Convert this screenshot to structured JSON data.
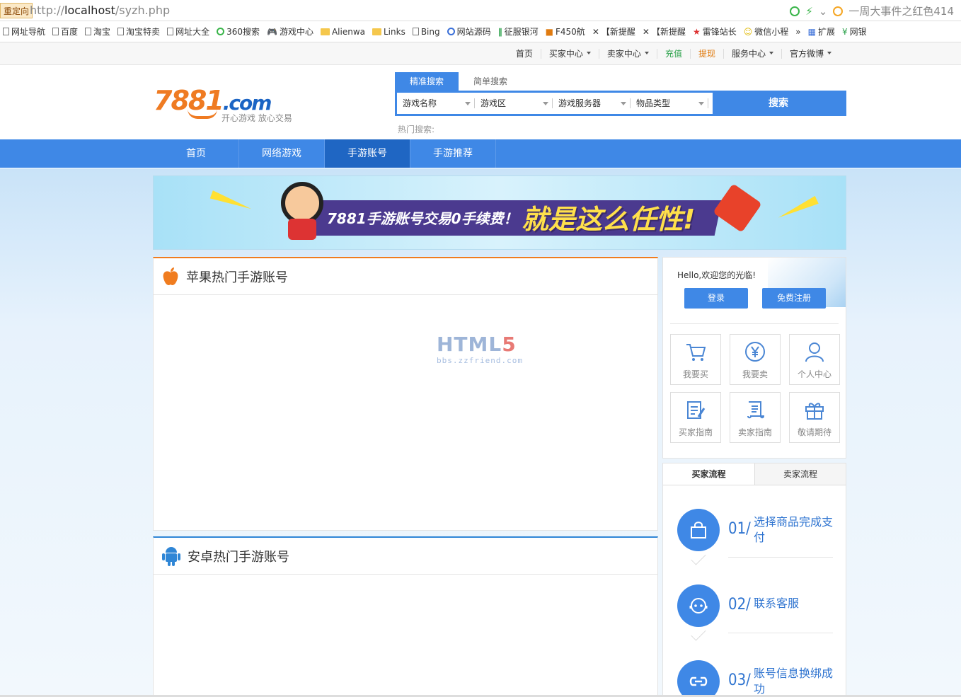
{
  "browser": {
    "redirect_label": "重定向",
    "url_prefix": "http://",
    "url_host": "localhost",
    "url_path": "/syzh.php",
    "right_text": "一周大事件之红色414",
    "bookmarks": [
      "网址导航",
      "百度",
      "淘宝",
      "淘宝特卖",
      "网址大全",
      "360搜索",
      "游戏中心",
      "Alienwa",
      "Links",
      "Bing",
      "网站源码",
      "征服银河",
      "F450航",
      "【新提醒",
      "【新提醒",
      "雷锋站长",
      "微信小程",
      "»",
      "扩展",
      "网银"
    ]
  },
  "topnav": [
    "首页",
    "买家中心",
    "卖家中心",
    "充值",
    "提现",
    "服务中心",
    "官方微博"
  ],
  "logo": {
    "main": "7881",
    "suffix": ".com",
    "slogan": "开心游戏 放心交易"
  },
  "search": {
    "tabs": [
      "精准搜索",
      "简单搜索"
    ],
    "selects": [
      "游戏名称",
      "游戏区",
      "游戏服务器",
      "物品类型"
    ],
    "button": "搜索",
    "hot_label": "热门搜索:"
  },
  "mainnav": [
    "首页",
    "网络游戏",
    "手游账号",
    "手游推荐"
  ],
  "banner": {
    "text1": "7881手游账号交易0手续费！",
    "text2": "就是这么任性!"
  },
  "panels": {
    "apple_title": "苹果热门手游账号",
    "android_title": "安卓热门手游账号",
    "watermark_main": "HTML",
    "watermark_num": "5",
    "watermark_sub": "bbs.zzfriend.com"
  },
  "sidebar": {
    "hello": "Hello,欢迎您的光临!",
    "login": "登录",
    "register": "免费注册",
    "grid": [
      "我要买",
      "我要卖",
      "个人中心",
      "买家指南",
      "卖家指南",
      "敬请期待"
    ]
  },
  "process": {
    "tabs": [
      "买家流程",
      "卖家流程"
    ],
    "steps": [
      {
        "num": "01/",
        "text": "选择商品完成支付"
      },
      {
        "num": "02/",
        "text": "联系客服"
      },
      {
        "num": "03/",
        "text": "账号信息换绑成功"
      }
    ]
  },
  "colors": {
    "primary": "#3f88e6",
    "orange": "#f07c1f",
    "green": "#2aa14a"
  }
}
